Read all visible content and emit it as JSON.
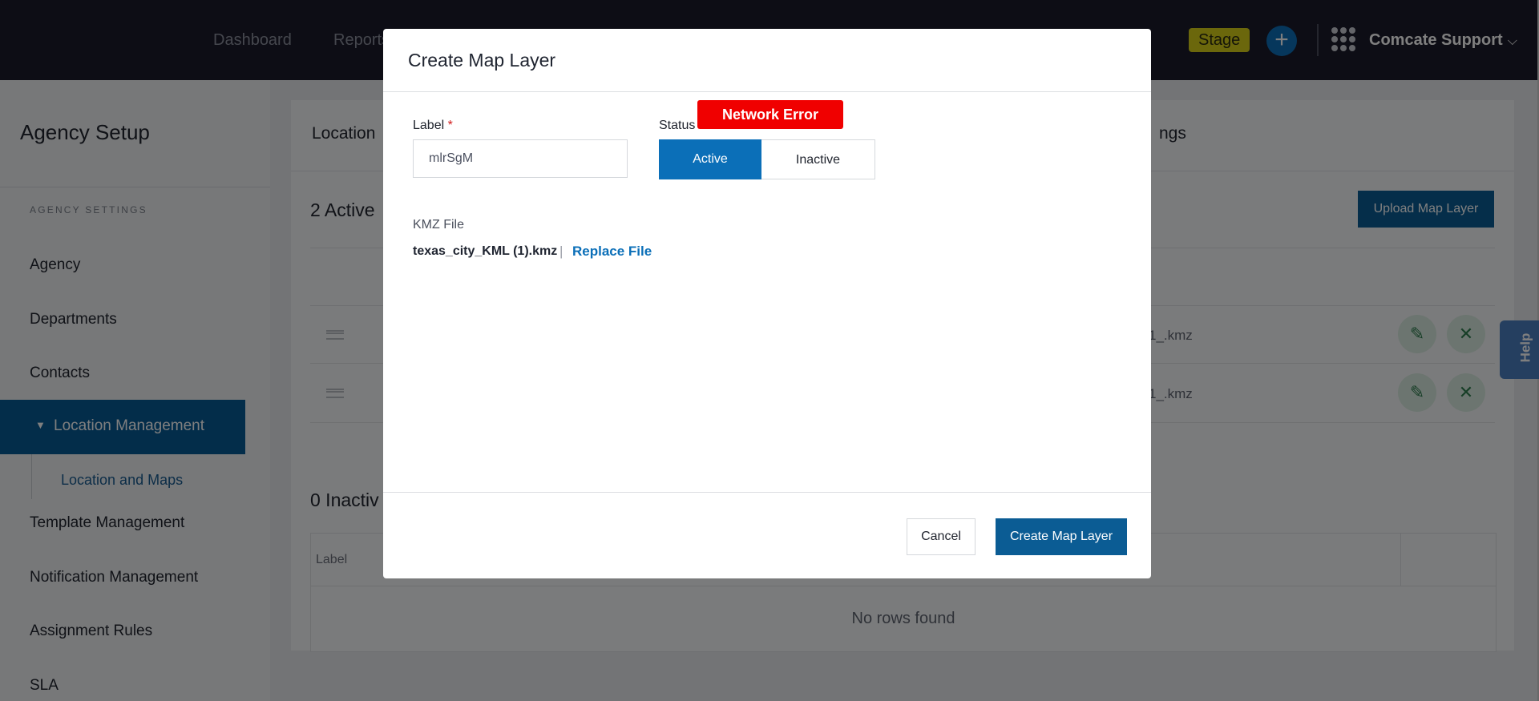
{
  "topbar": {
    "nav": [
      "Dashboard",
      "Reports"
    ],
    "stage_badge": "Stage",
    "plus_label": "+",
    "user_name": "Comcate Support",
    "user_chevron": "⌵"
  },
  "sidebar": {
    "title": "Agency Setup",
    "section": "AGENCY SETTINGS",
    "items": [
      "Agency",
      "Departments",
      "Contacts"
    ],
    "active_item": "Location Management",
    "sub_item": "Location and Maps",
    "items_after": [
      "Template Management",
      "Notification Management",
      "Assignment Rules",
      "SLA"
    ]
  },
  "main": {
    "tab_left": "Location",
    "tab_right": "ngs",
    "active_title": "2 Active",
    "upload_button": "Upload Map Layer",
    "rows": [
      {
        "file_suffix": "1_.kmz"
      },
      {
        "file_suffix": "1_.kmz"
      }
    ],
    "inactive_title": "0 Inactiv",
    "inactive_header_label": "Label",
    "no_rows": "No rows found"
  },
  "help_tab": "Help",
  "modal": {
    "title": "Create Map Layer",
    "label_field": "Label",
    "label_required": "*",
    "label_value": "mlrSgM",
    "status_field": "Status",
    "status_options": [
      "Active",
      "Inactive"
    ],
    "status_selected": "Active",
    "error_toast": "Network Error",
    "kmz_label": "KMZ File",
    "file_name": "texas_city_KML (1).kmz",
    "file_separator": "|",
    "replace_link": "Replace File",
    "cancel_button": "Cancel",
    "create_button": "Create Map Layer"
  },
  "colors": {
    "brand_blue": "#0b5c94",
    "error_red": "#f00000",
    "stage_yellow": "#d6cf18",
    "topbar": "#1b1b2a"
  },
  "icons": {
    "edit": "pencil-icon",
    "remove": "close-icon",
    "apps": "grid-icon",
    "add": "plus-icon",
    "drag": "drag-handle-icon"
  }
}
